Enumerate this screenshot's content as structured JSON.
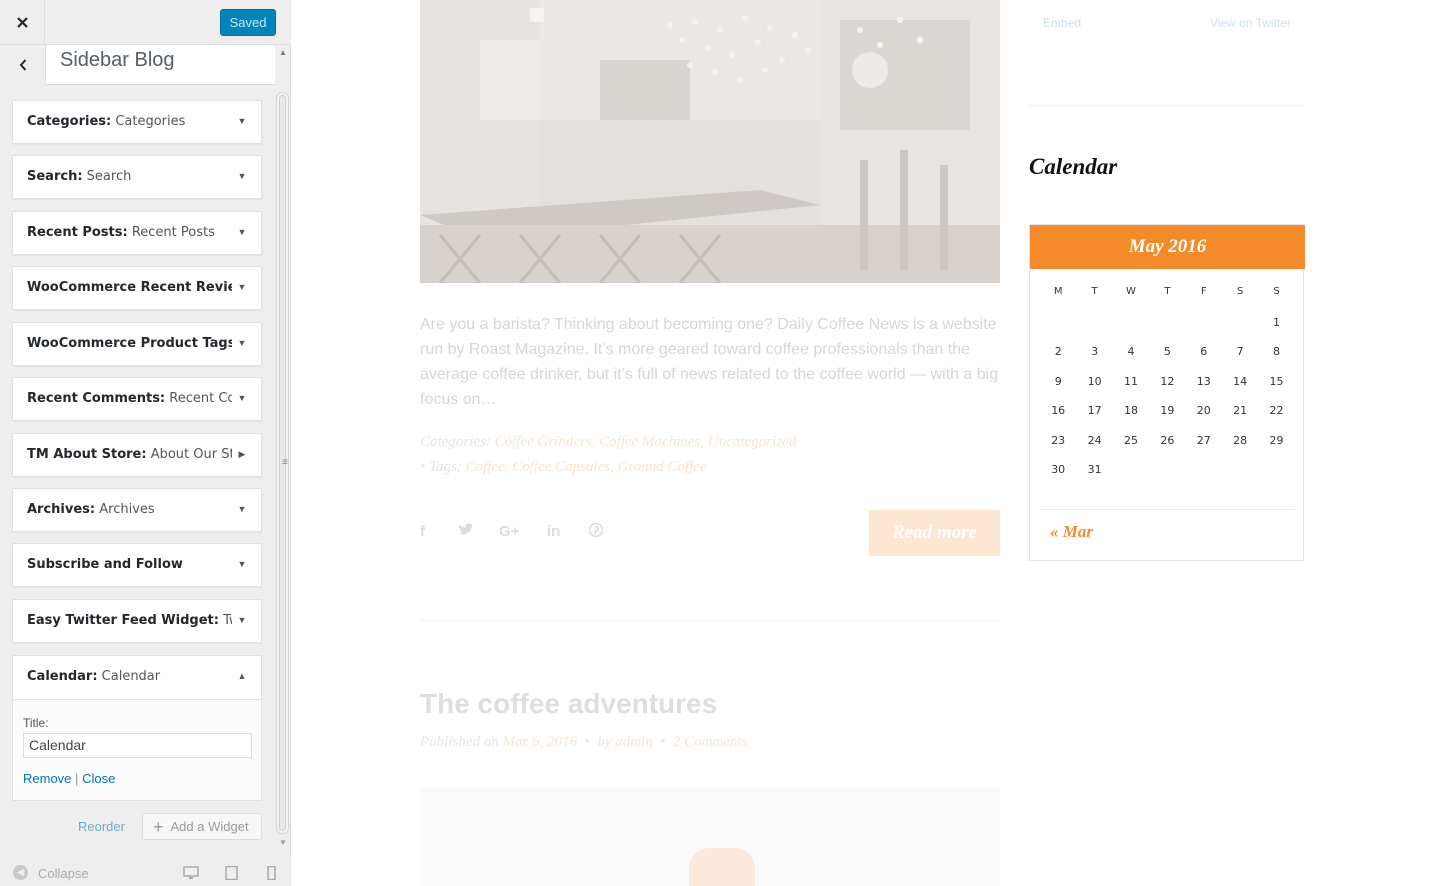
{
  "customizer": {
    "close_icon": "close-icon",
    "saved_label": "Saved",
    "section_title": "Sidebar Blog",
    "widgets": [
      {
        "name": "Categories:",
        "title": " Categories"
      },
      {
        "name": "Search:",
        "title": " Search"
      },
      {
        "name": "Recent Posts:",
        "title": " Recent Posts"
      },
      {
        "name": "WooCommerce Recent Revie...",
        "title": ""
      },
      {
        "name": "WooCommerce Product Tags:...",
        "title": ""
      },
      {
        "name": "Recent Comments:",
        "title": " Recent Co..."
      },
      {
        "name": "TM About Store:",
        "title": " About Our St..."
      },
      {
        "name": "Archives:",
        "title": " Archives"
      },
      {
        "name": "Subscribe and Follow",
        "title": ""
      },
      {
        "name": "Easy Twitter Feed Widget:",
        "title": " Twi..."
      }
    ],
    "open_widget": {
      "name": "Calendar:",
      "title": " Calendar",
      "field_label": "Title:",
      "field_value": "Calendar",
      "remove_label": "Remove",
      "separator": "|",
      "close_label": "Close"
    },
    "reorder_label": "Reorder",
    "add_widget_label": "Add a Widget",
    "collapse_label": "Collapse"
  },
  "preview": {
    "excerpt": "Are you a barista? Thinking about becoming one? Daily Coffee News is a website run by Roast Magazine. It’s more geared toward coffee professionals than the average coffee drinker, but it’s full of news related to the coffee world — with a big focus on…",
    "categories_label": "Categories:",
    "categories": "Coffee Grinders, Coffee Machines, Uncategorized",
    "tags_label": "Tags:",
    "tags": "Coffee, Coffee Capsules, Ground Coffee",
    "read_more": "Read more",
    "post2_title": "The coffee adventures",
    "post2_published": "Published on",
    "post2_date": "Mar 6, 2016",
    "post2_by": "by",
    "post2_author": "admin",
    "post2_comments": "2 Comments",
    "twitter_embed": "Embed",
    "twitter_view": "View on Twitter",
    "calendar": {
      "heading": "Calendar",
      "month": "May 2016",
      "weekdays": [
        "M",
        "T",
        "W",
        "T",
        "F",
        "S",
        "S"
      ],
      "weeks": [
        [
          "",
          "",
          "",
          "",
          "",
          "",
          "1"
        ],
        [
          "2",
          "3",
          "4",
          "5",
          "6",
          "7",
          "8"
        ],
        [
          "9",
          "10",
          "11",
          "12",
          "13",
          "14",
          "15"
        ],
        [
          "16",
          "17",
          "18",
          "19",
          "20",
          "21",
          "22"
        ],
        [
          "23",
          "24",
          "25",
          "26",
          "27",
          "28",
          "29"
        ],
        [
          "30",
          "31",
          "",
          "",
          "",
          "",
          ""
        ]
      ],
      "prev_link": "« Mar"
    }
  },
  "colors": {
    "primary_button": "#0085ba",
    "link": "#0073aa",
    "accent": "#f58a2b"
  }
}
